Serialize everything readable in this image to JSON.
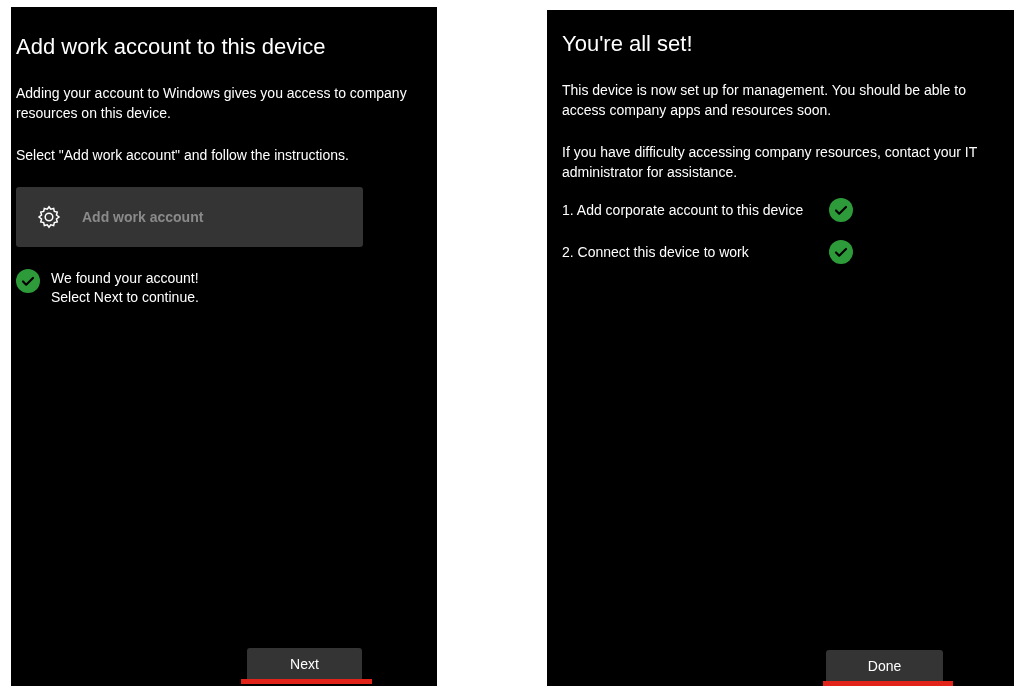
{
  "screens": [
    {
      "title": "Add work account to this device",
      "items": [
        {
          "kind": "paragraph",
          "text": "Adding your account to Windows gives you access to company resources on this device."
        },
        {
          "kind": "paragraph",
          "text": "Select \"Add work account\" and follow the instructions."
        },
        {
          "kind": "action",
          "label": "Add work account",
          "disabled": true
        },
        {
          "kind": "status",
          "done": true,
          "lines": [
            "We found your account!",
            "Select Next to continue."
          ]
        }
      ],
      "button": {
        "label": "Next",
        "highlighted": true
      }
    },
    {
      "title": "You're all set!",
      "items": [
        {
          "kind": "paragraph",
          "text": "This device is now set up for management.  You should be able to access company apps and resources soon."
        },
        {
          "kind": "paragraph",
          "text": "If you have difficulty accessing company resources, contact your IT administrator for assistance."
        },
        {
          "kind": "step",
          "label": "1. Add corporate account to this device",
          "done": true
        },
        {
          "kind": "step",
          "label": "2. Connect this device to work",
          "done": true
        }
      ],
      "button": {
        "label": "Done",
        "highlighted": true
      }
    }
  ]
}
